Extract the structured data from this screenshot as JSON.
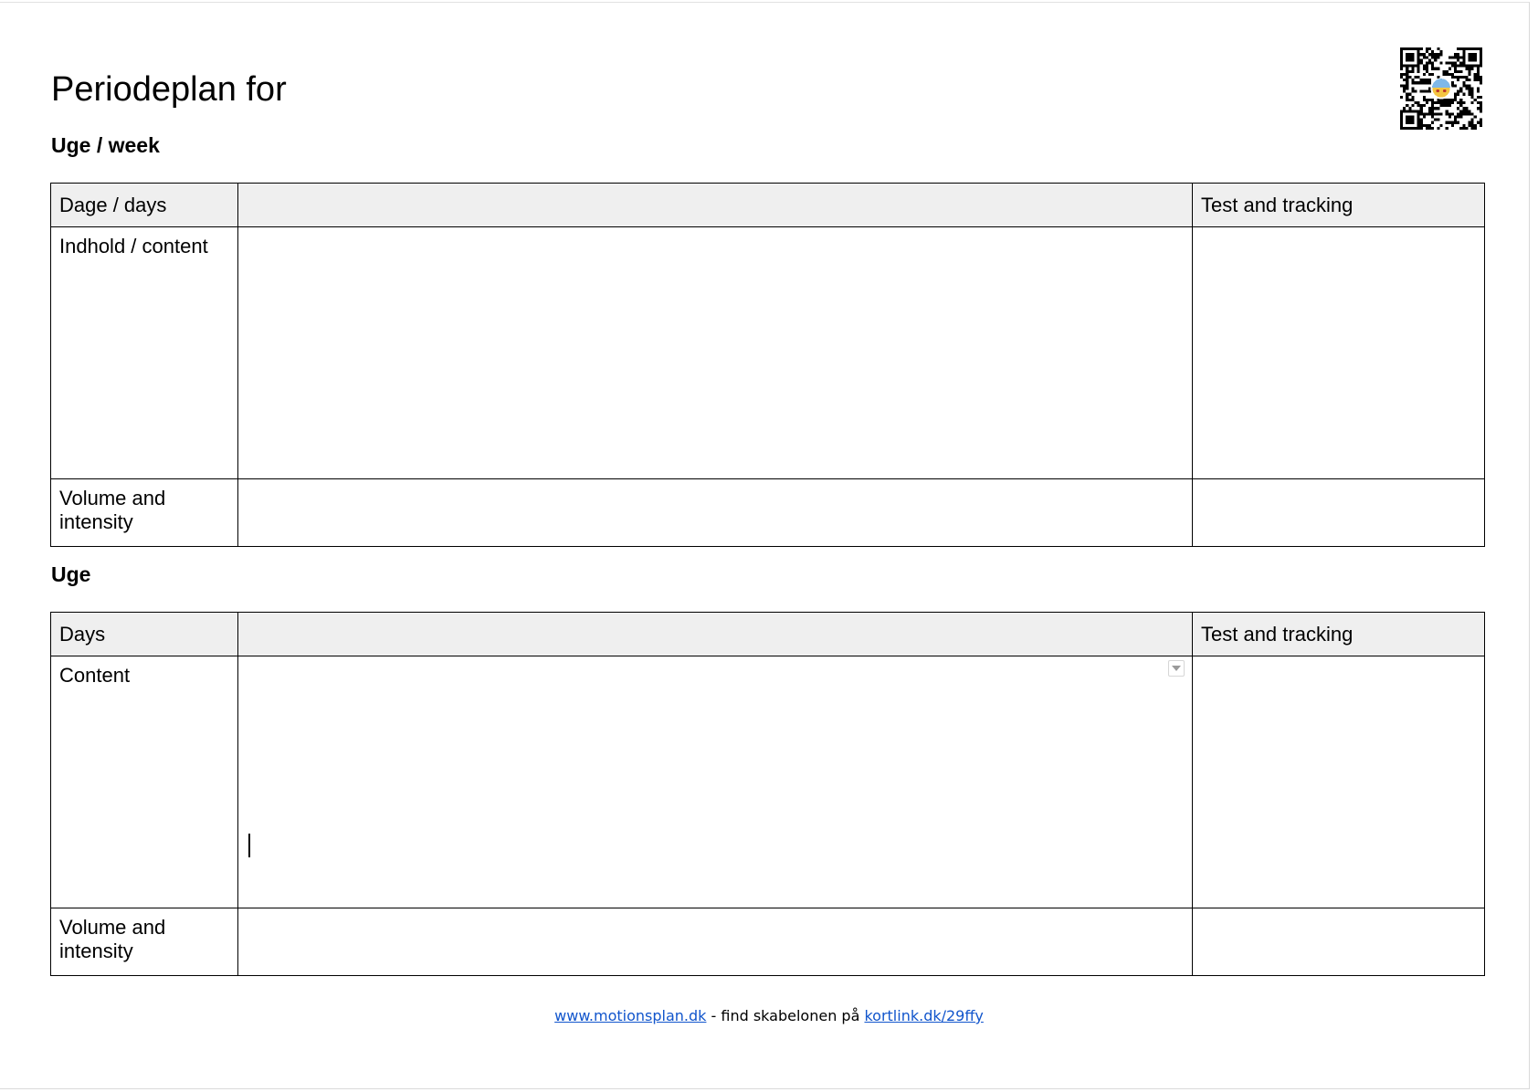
{
  "document": {
    "title": "Periodeplan for"
  },
  "qr_code": {
    "icon": "qr-code-icon"
  },
  "sections": [
    {
      "heading": "Uge / week",
      "header_row": [
        "Dage / days",
        "",
        "Test and tracking"
      ],
      "content_label": "Indhold / content",
      "volume_label": "Volume and intensity"
    },
    {
      "heading": "Uge",
      "header_row": [
        "Days",
        "",
        "Test and tracking"
      ],
      "content_label": "Content",
      "volume_label": "Volume and intensity"
    }
  ],
  "footer": {
    "site_link": "www.motionsplan.dk",
    "middle_text": " - find skabelonen på ",
    "template_link": "kortlink.dk/29ffy"
  },
  "colors": {
    "header_bg": "#efefef",
    "link": "#1155cc",
    "border": "#000000"
  }
}
